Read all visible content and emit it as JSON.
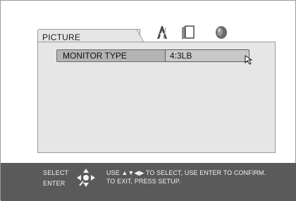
{
  "menu": {
    "active_tab": "PICTURE",
    "tabs_icons": [
      "language-icon",
      "screen-icon",
      "audio-icon"
    ]
  },
  "settings": {
    "rows": [
      {
        "label": "MONITOR TYPE",
        "value": "4:3LB"
      }
    ]
  },
  "footer": {
    "select_label": "SELECT",
    "enter_label": "ENTER",
    "help_line1": "USE ▲▼◀▶ TO SELECT,  USE ENTER TO CONFIRM.",
    "help_line2": "TO EXIT, PRESS SETUP."
  },
  "colors": {
    "panel_bg": "#e6e6e6",
    "footer_bg": "#5a5a5a",
    "row_highlight": "#b3b3b3"
  }
}
